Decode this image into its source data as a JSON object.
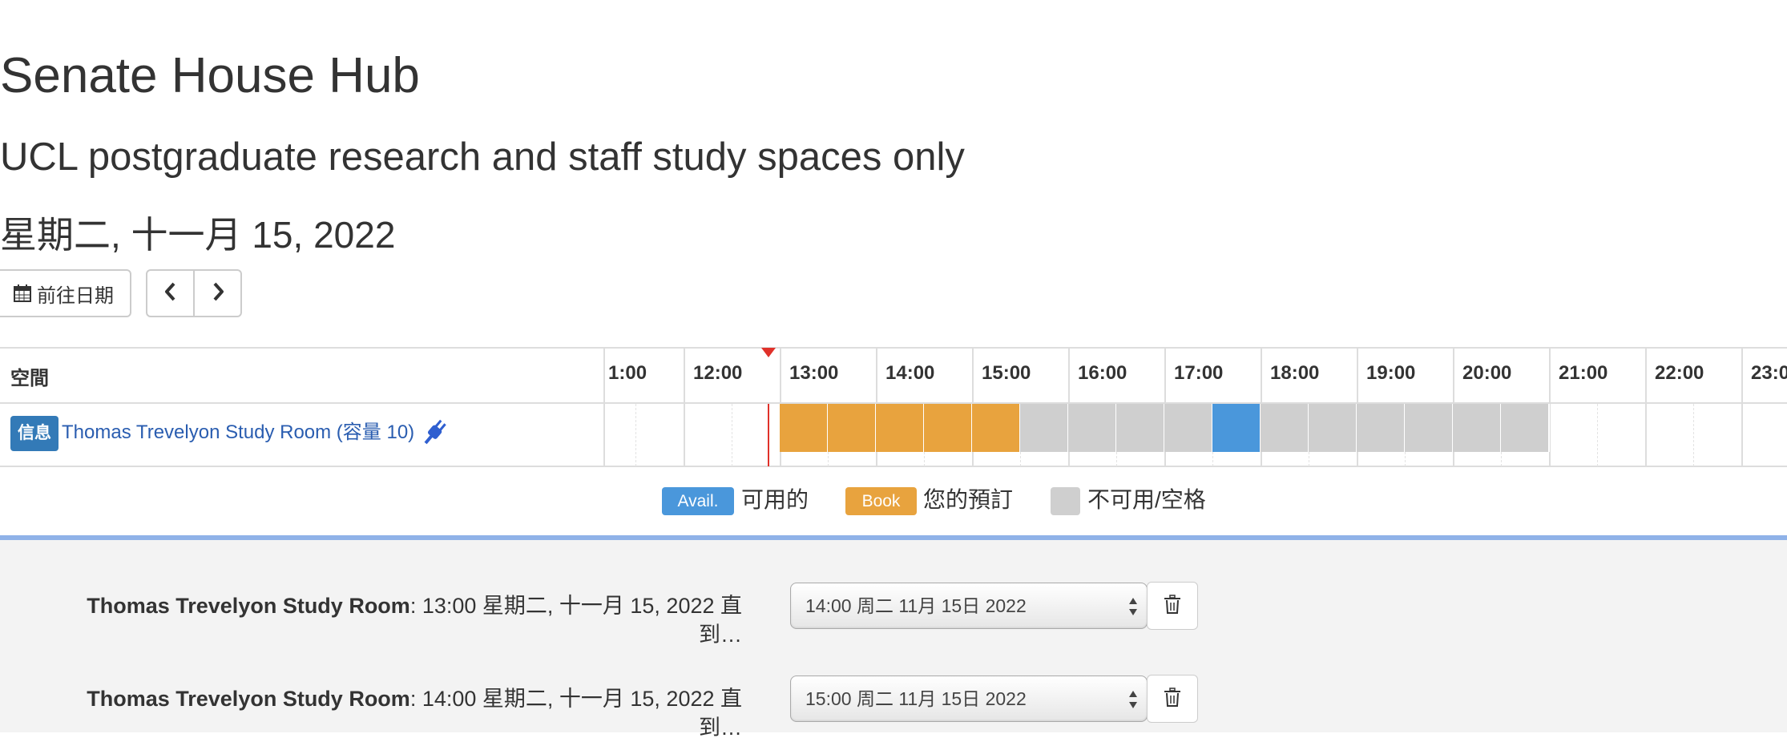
{
  "header": {
    "title": "Senate House Hub",
    "subtitle": "UCL postgraduate research and staff study spaces only",
    "date": "星期二, 十一月 15, 2022"
  },
  "toolbar": {
    "goto_date_label": "前往日期",
    "goto_date_icon": "calendar-icon",
    "prev_icon": "chevron-left-icon",
    "next_icon": "chevron-right-icon"
  },
  "grid": {
    "space_column_label": "空間",
    "hours": [
      "1:00",
      "12:00",
      "13:00",
      "14:00",
      "15:00",
      "16:00",
      "17:00",
      "18:00",
      "19:00",
      "20:00",
      "21:00",
      "22:00",
      "23:0"
    ],
    "current_time": "12:45",
    "rooms": [
      {
        "info_label": "信息",
        "name": "Thomas Trevelyon Study Room (容量 10)",
        "icon": "power-plug-icon",
        "slots": [
          {
            "start": "13:00",
            "status": "booked"
          },
          {
            "start": "13:30",
            "status": "booked"
          },
          {
            "start": "14:00",
            "status": "booked"
          },
          {
            "start": "14:30",
            "status": "booked"
          },
          {
            "start": "15:00",
            "status": "booked"
          },
          {
            "start": "15:30",
            "status": "unavailable"
          },
          {
            "start": "16:00",
            "status": "unavailable"
          },
          {
            "start": "16:30",
            "status": "unavailable"
          },
          {
            "start": "17:00",
            "status": "unavailable"
          },
          {
            "start": "17:30",
            "status": "available"
          },
          {
            "start": "18:00",
            "status": "unavailable"
          },
          {
            "start": "18:30",
            "status": "unavailable"
          },
          {
            "start": "19:00",
            "status": "unavailable"
          },
          {
            "start": "19:30",
            "status": "unavailable"
          },
          {
            "start": "20:00",
            "status": "unavailable"
          },
          {
            "start": "20:30",
            "status": "unavailable"
          }
        ]
      }
    ]
  },
  "legend": {
    "available_chip": "Avail.",
    "available_text": "可用的",
    "booked_chip": "Book",
    "booked_text": "您的預訂",
    "unavailable_text": "不可用/空格"
  },
  "basket": {
    "items": [
      {
        "room": "Thomas Trevelyon Study Room",
        "start_text": ": 13:00 星期二, 十一月 15, 2022 直到…",
        "end_value": "14:00 周二 11月 15日 2022"
      },
      {
        "room": "Thomas Trevelyon Study Room",
        "start_text": ": 14:00 星期二, 十一月 15, 2022 直到…",
        "end_value": "15:00 周二 11月 15日 2022"
      }
    ],
    "delete_icon": "trash-icon"
  },
  "colors": {
    "booked": "#e8a33e",
    "available": "#4a97db",
    "unavailable": "#cfcfcf",
    "info_badge": "#337ab7",
    "link": "#2a5db0",
    "now_marker": "#e0312a",
    "basket_border": "#8fb2e8"
  }
}
